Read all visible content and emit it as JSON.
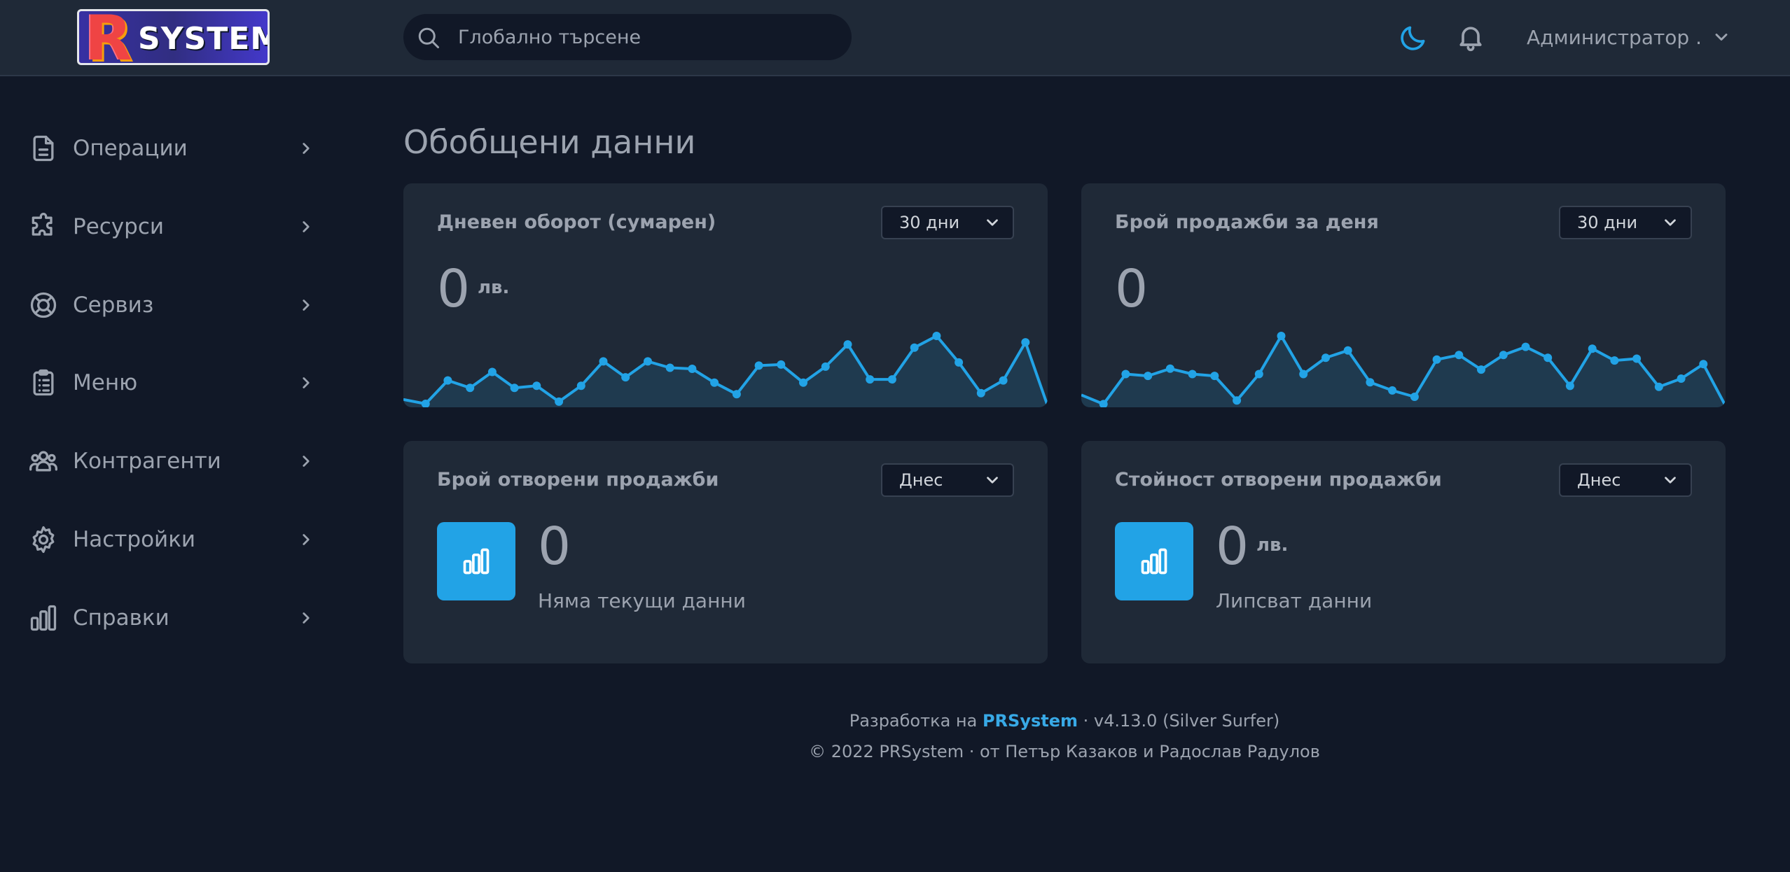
{
  "header": {
    "logo_letter": "R",
    "logo_text": "SYSTEM",
    "search_placeholder": "Глобално търсене",
    "user_name": "Администратор ."
  },
  "sidebar": {
    "items": [
      {
        "label": "Операции",
        "icon": "document-icon"
      },
      {
        "label": "Ресурси",
        "icon": "puzzle-icon"
      },
      {
        "label": "Сервиз",
        "icon": "lifebuoy-icon"
      },
      {
        "label": "Меню",
        "icon": "clipboard-icon"
      },
      {
        "label": "Контрагенти",
        "icon": "users-icon"
      },
      {
        "label": "Настройки",
        "icon": "gear-icon"
      },
      {
        "label": "Справки",
        "icon": "bar-chart-icon"
      }
    ]
  },
  "main": {
    "title": "Обобщени данни",
    "cards": [
      {
        "title": "Дневен оборот (сумарен)",
        "period": "30 дни",
        "value": "0",
        "unit": "лв."
      },
      {
        "title": "Брой продажби за деня",
        "period": "30 дни",
        "value": "0"
      },
      {
        "title": "Брой отворени продажби",
        "period": "Днес",
        "value": "0",
        "label": "Няма текущи данни"
      },
      {
        "title": "Стойност отворени продажби",
        "period": "Днес",
        "value": "0",
        "unit": "лв.",
        "label": "Липсват данни"
      }
    ]
  },
  "chart_data": [
    {
      "type": "area",
      "values": [
        6,
        2,
        24,
        17,
        32,
        17,
        19,
        4,
        19,
        42,
        27,
        42,
        36,
        35,
        22,
        11,
        38,
        39,
        22,
        37,
        58,
        25,
        25,
        55,
        66,
        41,
        12,
        24,
        60,
        0
      ]
    },
    {
      "type": "area",
      "values": [
        12,
        2,
        35,
        33,
        41,
        35,
        33,
        6,
        35,
        77,
        35,
        53,
        61,
        26,
        17,
        10,
        51,
        56,
        40,
        56,
        65,
        53,
        22,
        63,
        50,
        52,
        21,
        30,
        46,
        0
      ]
    }
  ],
  "footer": {
    "line1_prefix": "Разработка на",
    "line1_brand": "PRSystem",
    "line1_suffix": "· v4.13.0 (Silver Surfer)",
    "line2": "© 2022 PRSystem · от Петър Казаков и Радослав Радулов"
  },
  "colors": {
    "accent": "#22a3e6",
    "background": "#111827",
    "card": "#1f2937"
  }
}
